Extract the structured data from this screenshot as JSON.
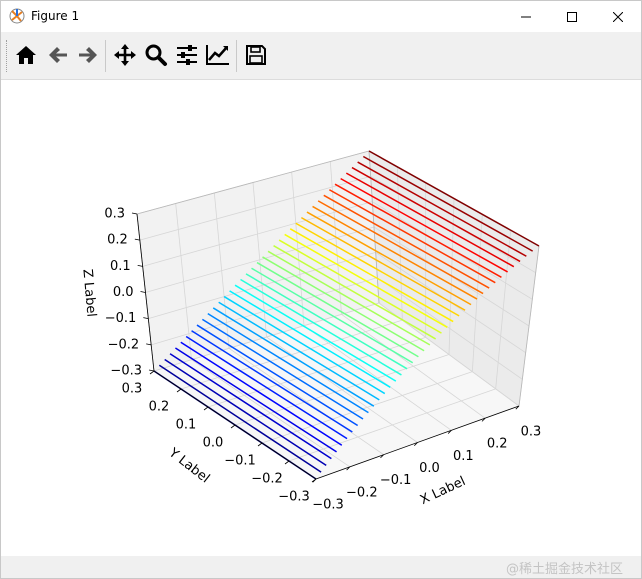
{
  "window": {
    "title": "Figure 1",
    "controls": [
      "minimize",
      "maximize",
      "close"
    ]
  },
  "toolbar": {
    "buttons": [
      {
        "name": "home",
        "icon": "home-icon"
      },
      {
        "name": "back",
        "icon": "arrow-left-icon"
      },
      {
        "name": "forward",
        "icon": "arrow-right-icon"
      },
      {
        "name": "pan",
        "icon": "move-icon"
      },
      {
        "name": "zoom",
        "icon": "magnifier-icon"
      },
      {
        "name": "configure-subplots",
        "icon": "sliders-icon"
      },
      {
        "name": "edit-axis",
        "icon": "line-chart-icon"
      },
      {
        "name": "save",
        "icon": "floppy-disk-icon"
      }
    ]
  },
  "chart_data": {
    "type": "line",
    "projection": "3d",
    "xlabel": "X Label",
    "ylabel": "Y Label",
    "zlabel": "Z Label",
    "xlim": [
      -0.3,
      0.3
    ],
    "ylim": [
      -0.3,
      0.3
    ],
    "zlim": [
      -0.3,
      0.3
    ],
    "x_ticks": [
      "−0.3",
      "−0.2",
      "−0.1",
      "0.0",
      "0.1",
      "0.2",
      "0.3"
    ],
    "y_ticks": [
      "−0.3",
      "−0.2",
      "−0.1",
      "0.0",
      "0.1",
      "0.2",
      "0.3"
    ],
    "z_ticks": [
      "−0.3",
      "−0.2",
      "−0.1",
      "0.0",
      "0.1",
      "0.2",
      "0.3"
    ],
    "grid": true,
    "colormap": "jet",
    "surface": "z = x",
    "line_direction": "along Y",
    "line_count": 40,
    "x_range": [
      -0.3,
      0.3
    ],
    "y_range": [
      -0.3,
      0.3
    ]
  },
  "watermark": "@稀土掘金技术社区"
}
